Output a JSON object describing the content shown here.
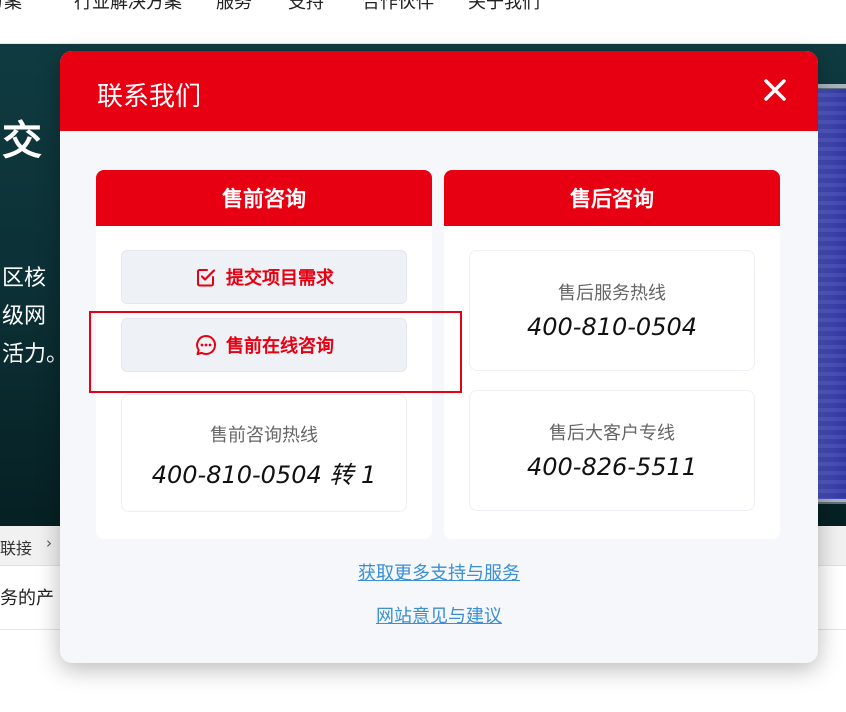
{
  "background": {
    "nav_items": [
      "方案",
      "行业解决方案",
      "服务",
      "支持",
      "合作伙伴",
      "关于我们"
    ],
    "hero": {
      "title": "交",
      "lines": [
        "区核",
        "级网",
        "活力。"
      ]
    },
    "breadcrumb": {
      "item": "联接",
      "separator": "›"
    },
    "intro_text": "务的产"
  },
  "modal": {
    "title": "联系我们",
    "close_icon": "close-icon",
    "presales": {
      "header": "售前咨询",
      "submit_button": "提交项目需求",
      "online_button": "售前在线咨询",
      "hotline_label": "售前咨询热线",
      "hotline_number": "400-810-0504 转 1"
    },
    "aftersales": {
      "header": "售后咨询",
      "service_label": "售后服务热线",
      "service_number": "400-810-0504",
      "vip_label": "售后大客户专线",
      "vip_number": "400-826-5511"
    },
    "links": {
      "more_support": "获取更多支持与服务",
      "feedback": "网站意见与建议"
    }
  },
  "colors": {
    "accent": "#e60012",
    "link": "#3a8fd6",
    "modal_bg": "#f5f7fa"
  }
}
